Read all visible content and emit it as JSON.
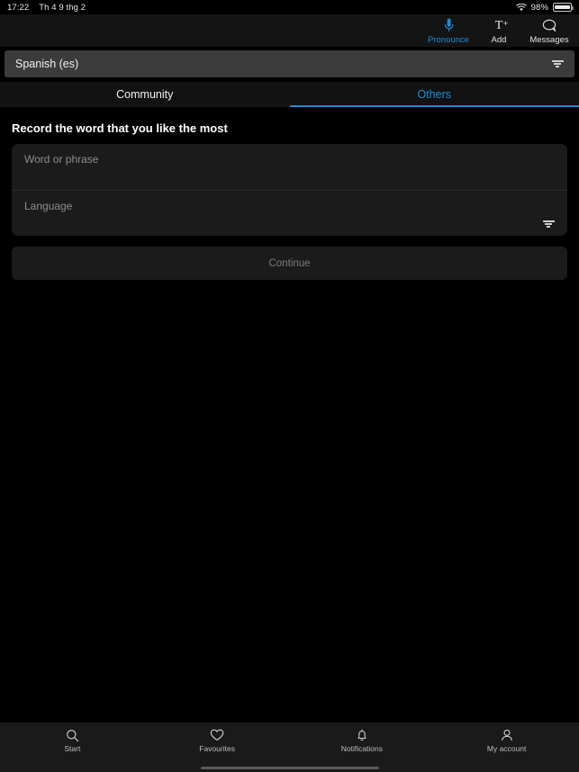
{
  "statusbar": {
    "time": "17:22",
    "date": "Th 4 9 thg 2",
    "battery_percent": "98%",
    "wifi_icon": "wifi-icon",
    "battery_icon": "battery-icon"
  },
  "toolbar": {
    "items": [
      {
        "label": "Pronounce",
        "icon": "microphone-icon",
        "active": true
      },
      {
        "label": "Add",
        "icon": "add-text-icon",
        "active": false
      },
      {
        "label": "Messages",
        "icon": "speech-bubble-icon",
        "active": false
      }
    ]
  },
  "language_bar": {
    "value": "Spanish (es)",
    "icon": "filter-icon"
  },
  "tabs": [
    {
      "label": "Community",
      "active": false
    },
    {
      "label": "Others",
      "active": true
    }
  ],
  "main": {
    "section_title": "Record the word that you like the most",
    "fields": [
      {
        "placeholder": "Word or phrase",
        "value": "",
        "icon": ""
      },
      {
        "placeholder": "Language",
        "value": "",
        "icon": "filter-icon"
      }
    ],
    "continue_label": "Continue"
  },
  "bottom_nav": {
    "items": [
      {
        "label": "Start",
        "icon": "search-icon"
      },
      {
        "label": "Favourites",
        "icon": "heart-icon"
      },
      {
        "label": "Notifications",
        "icon": "bell-icon"
      },
      {
        "label": "My account",
        "icon": "person-icon"
      }
    ]
  },
  "colors": {
    "accent": "#1a8cd8",
    "page_background": "#000000",
    "card_background": "#1b1b1b",
    "language_bar_background": "#3b3b3b",
    "nav_background": "#1a1a1a",
    "muted_text": "#8e8e8e"
  }
}
